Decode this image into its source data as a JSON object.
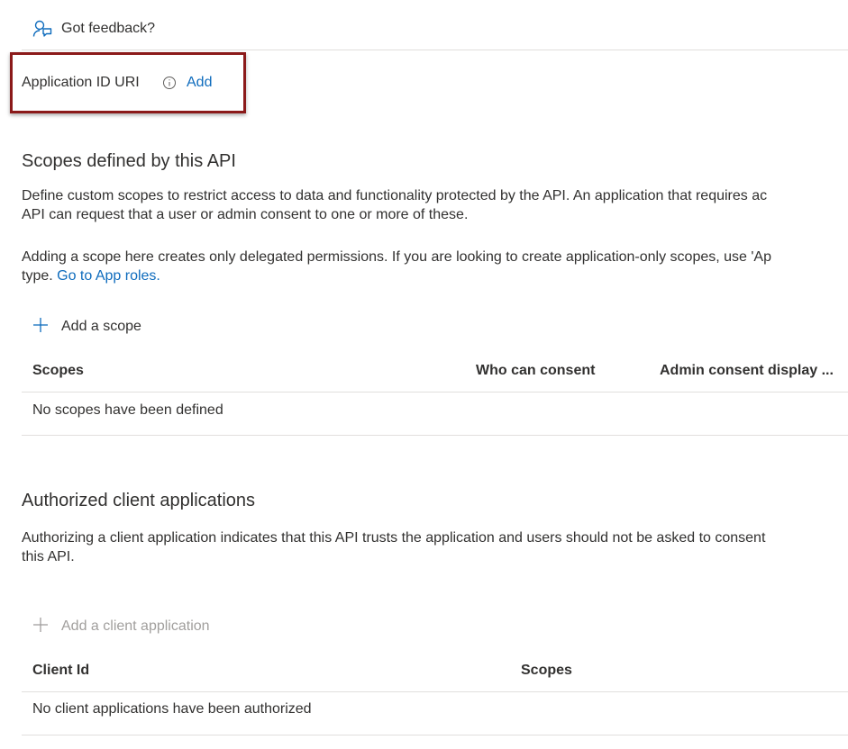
{
  "feedback": {
    "icon": "feedback-person-icon",
    "label": "Got feedback?"
  },
  "app_id_uri": {
    "label": "Application ID URI",
    "info_icon": "info-icon",
    "add_link": "Add",
    "highlight_color": "#8b1a1a"
  },
  "scopes_section": {
    "title": "Scopes defined by this API",
    "description_line1": "Define custom scopes to restrict access to data and functionality protected by the API. An application that requires ac",
    "description_line2": "API can request that a user or admin consent to one or more of these.",
    "note_line1": "Adding a scope here creates only delegated permissions. If you are looking to create application-only scopes, use 'Ap",
    "note_line2_prefix": "type.",
    "note_link": "Go to App roles.",
    "add_button": "Add a scope",
    "columns": [
      "Scopes",
      "Who can consent",
      "Admin consent display ..."
    ],
    "empty_message": "No scopes have been defined"
  },
  "clients_section": {
    "title": "Authorized client applications",
    "description_line1": "Authorizing a client application indicates that this API trusts the application and users should not be asked to consent",
    "description_line2": "this API.",
    "add_button": "Add a client application",
    "columns": [
      "Client Id",
      "Scopes"
    ],
    "empty_message": "No client applications have been authorized"
  },
  "colors": {
    "link": "#0f6cbd",
    "text": "#323130",
    "disabled": "#a19f9d",
    "divider": "#e1dfdd"
  }
}
